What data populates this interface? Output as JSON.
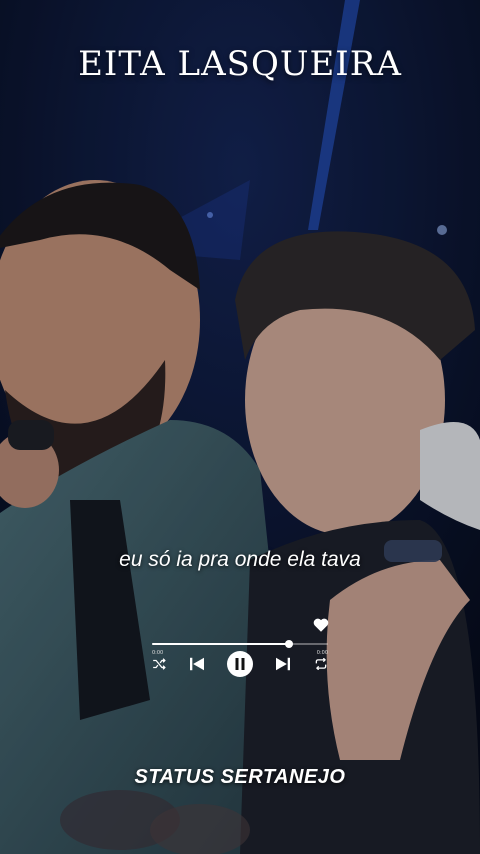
{
  "header": {
    "title": "EITA LASQUEIRA"
  },
  "lyrics": {
    "line": "eu só ia pra onde ela tava"
  },
  "player": {
    "progress": 0.78,
    "elapsed": "0:00",
    "total": "0:00",
    "state": "playing",
    "icons": [
      "heart-icon",
      "shuffle-icon",
      "previous-icon",
      "pause-icon",
      "next-icon",
      "repeat-icon"
    ]
  },
  "footer": {
    "brand": "STATUS SERTANEJO"
  },
  "colors": {
    "background": "#050a1c",
    "stage_light": "#2a5bd6",
    "text": "#ffffff"
  }
}
